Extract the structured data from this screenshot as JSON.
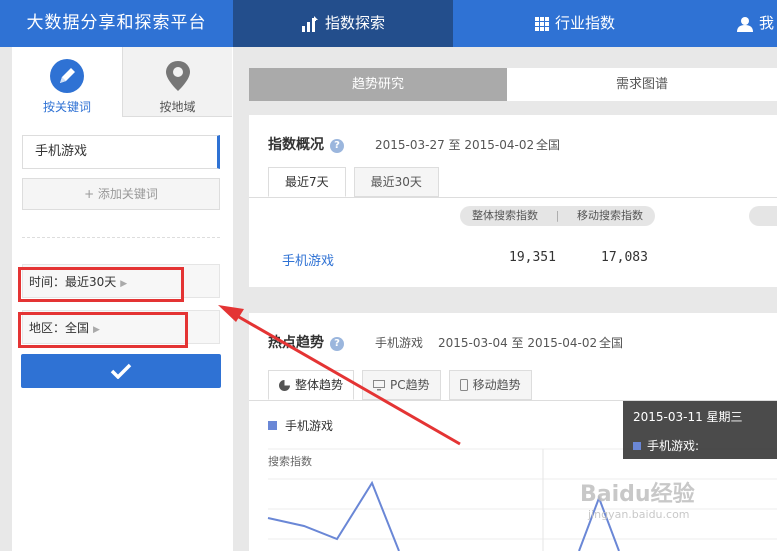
{
  "brand": "大数据分享和探索平台",
  "nav": [
    {
      "label": "指数探索",
      "active": true
    },
    {
      "label": "行业指数",
      "active": false
    },
    {
      "label": "我",
      "active": false
    }
  ],
  "left_tabs": [
    {
      "label": "按关键词",
      "active": true
    },
    {
      "label": "按地域",
      "active": false
    }
  ],
  "keyword_value": "手机游戏",
  "add_keyword_label": "+ 添加关键词",
  "filters": {
    "time_label": "时间：最近30天",
    "region_label": "地区：全国"
  },
  "main_tabs": [
    "趋势研究",
    "需求图谱"
  ],
  "overview": {
    "title": "指数概况",
    "date_range": "2015-03-27 至 2015-04-02",
    "region": "全国",
    "tabs": [
      "最近7天",
      "最近30天"
    ],
    "columns": [
      "整体搜索指数",
      "移动搜索指数"
    ],
    "row": {
      "keyword": "手机游戏",
      "overall": "19,351",
      "mobile": "17,083"
    }
  },
  "trend": {
    "title": "热点趋势",
    "keyword": "手机游戏",
    "date_range": "2015-03-04 至 2015-04-02",
    "region": "全国",
    "tabs": [
      "整体趋势",
      "PC趋势",
      "移动趋势"
    ],
    "legend": "手机游戏",
    "ylabel": "搜索指数",
    "series_color": "#6a87d6"
  },
  "tooltip": {
    "date": "2015-03-11 星期三",
    "series": "手机游戏:"
  },
  "watermark": {
    "brand": "Baidu经验",
    "url": "jingyan.baidu.com"
  },
  "colors": {
    "accent": "#2f72d4",
    "nav_active": "#234e8c",
    "highlight": "#e43434"
  }
}
